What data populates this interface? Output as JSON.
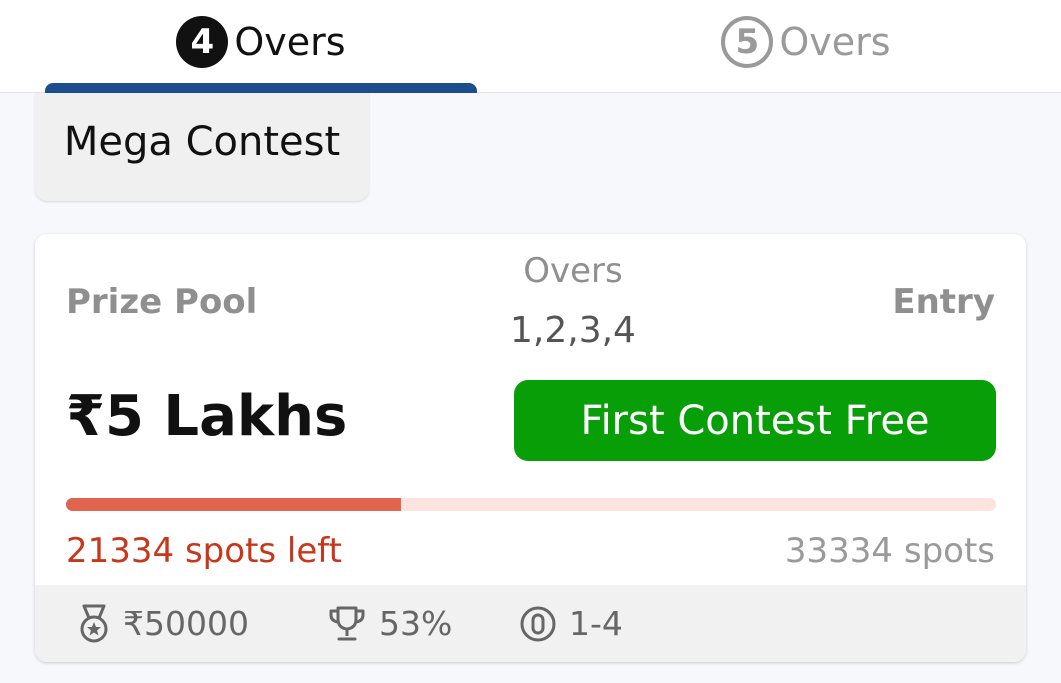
{
  "tabs": [
    {
      "number": "4",
      "label": "Overs",
      "active": true
    },
    {
      "number": "5",
      "label": "Overs",
      "active": false
    }
  ],
  "contest_category": "Mega Contest",
  "card": {
    "prize_pool_label": "Prize Pool",
    "prize_pool_value": "₹5 Lakhs",
    "overs_label": "Overs",
    "overs_value": "1,2,3,4",
    "entry_label": "Entry",
    "entry_button": "First Contest Free",
    "spots_left": "21334 spots left",
    "total_spots": "33334 spots",
    "filled_fraction": 0.36,
    "footer": {
      "first_prize": "₹50000",
      "first_prize_icon": "medal-icon",
      "winners_percent": "53%",
      "winners_icon": "trophy-icon",
      "team_limit": "1-4",
      "team_limit_icon": "single-entry-icon"
    }
  },
  "colors": {
    "active_tab_indicator": "#1c4e8d",
    "entry_button": "#079e07",
    "progress_fill": "#e0644e",
    "progress_track": "#fde3de",
    "spots_left": "#c8361b"
  }
}
